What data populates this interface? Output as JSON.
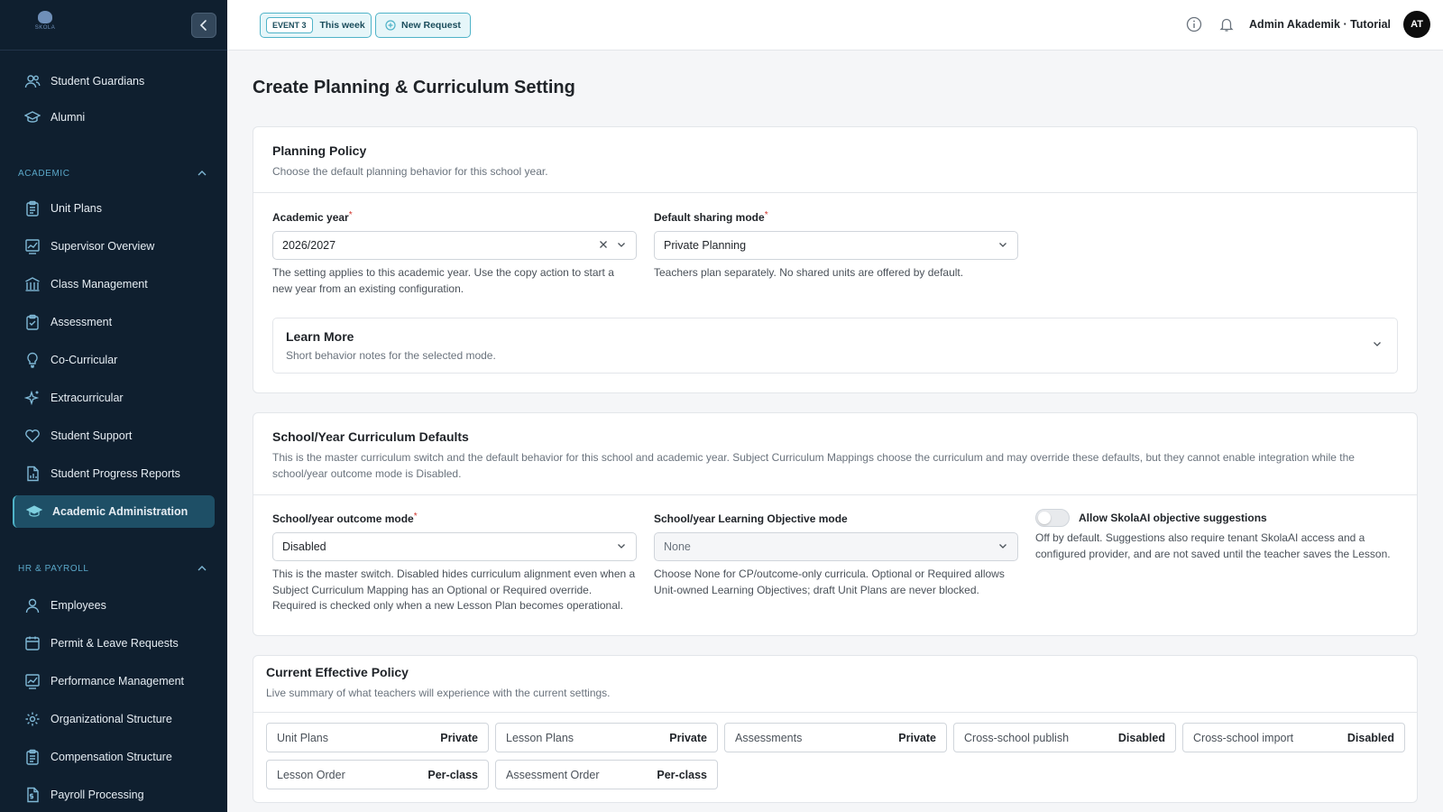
{
  "sidebar": {
    "logo_text": "SKOLA",
    "items_top": [
      {
        "label": "Student Guardians",
        "icon": "users-icon"
      },
      {
        "label": "Alumni",
        "icon": "graduation-cap-icon"
      }
    ],
    "academic_header": "ACADEMIC",
    "academic_items": [
      {
        "label": "Unit Plans",
        "icon": "clipboard-icon"
      },
      {
        "label": "Supervisor Overview",
        "icon": "chart-icon"
      },
      {
        "label": "Class Management",
        "icon": "building-icon"
      },
      {
        "label": "Assessment",
        "icon": "clipboard-check-icon"
      },
      {
        "label": "Co-Curricular",
        "icon": "lightbulb-icon"
      },
      {
        "label": "Extracurricular",
        "icon": "sparkles-icon"
      },
      {
        "label": "Student Support",
        "icon": "heart-icon"
      },
      {
        "label": "Student Progress Reports",
        "icon": "document-chart-icon"
      },
      {
        "label": "Academic Administration",
        "icon": "graduation-cap-icon",
        "active": true
      }
    ],
    "hr_header": "HR & PAYROLL",
    "hr_items": [
      {
        "label": "Employees",
        "icon": "user-icon"
      },
      {
        "label": "Permit & Leave Requests",
        "icon": "calendar-icon"
      },
      {
        "label": "Performance Management",
        "icon": "chart-icon"
      },
      {
        "label": "Organizational Structure",
        "icon": "gear-icon"
      },
      {
        "label": "Compensation Structure",
        "icon": "clipboard-icon"
      },
      {
        "label": "Payroll Processing",
        "icon": "document-dollar-icon"
      }
    ]
  },
  "topbar": {
    "event_badge": "EVENT 3",
    "event_label": "This week",
    "new_request_label": "New Request",
    "user_name": "Admin Akademik · Tutorial",
    "avatar_initials": "AT"
  },
  "page_title": "Create Planning & Curriculum Setting",
  "planning_policy": {
    "title": "Planning Policy",
    "description": "Choose the default planning behavior for this school year.",
    "academic_year": {
      "label": "Academic year",
      "required_mark": "*",
      "value": "2026/2027",
      "help": "The setting applies to this academic year. Use the copy action to start a new year from an existing configuration."
    },
    "sharing_mode": {
      "label": "Default sharing mode",
      "required_mark": "*",
      "value": "Private Planning",
      "help": "Teachers plan separately. No shared units are offered by default."
    },
    "learn_more": {
      "title": "Learn More",
      "description": "Short behavior notes for the selected mode."
    }
  },
  "curriculum_defaults": {
    "title": "School/Year Curriculum Defaults",
    "description": "This is the master curriculum switch and the default behavior for this school and academic year. Subject Curriculum Mappings choose the curriculum and may override these defaults, but they cannot enable integration while the school/year outcome mode is Disabled.",
    "outcome_mode": {
      "label": "School/year outcome mode",
      "required_mark": "*",
      "value": "Disabled",
      "help": "This is the master switch. Disabled hides curriculum alignment even when a Subject Curriculum Mapping has an Optional or Required override. Required is checked only when a new Lesson Plan becomes operational."
    },
    "objective_mode": {
      "label": "School/year Learning Objective mode",
      "value": "None",
      "help": "Choose None for CP/outcome-only curricula. Optional or Required allows Unit-owned Learning Objectives; draft Unit Plans are never blocked."
    },
    "ai_toggle": {
      "label": "Allow SkolaAI objective suggestions",
      "enabled": false,
      "help": "Off by default. Suggestions also require tenant SkolaAI access and a configured provider, and are not saved until the teacher saves the Lesson."
    }
  },
  "effective_policy": {
    "title": "Current Effective Policy",
    "description": "Live summary of what teachers will experience with the current settings.",
    "cells": [
      {
        "key": "Unit Plans",
        "value": "Private"
      },
      {
        "key": "Lesson Plans",
        "value": "Private"
      },
      {
        "key": "Assessments",
        "value": "Private"
      },
      {
        "key": "Cross-school publish",
        "value": "Disabled"
      },
      {
        "key": "Cross-school import",
        "value": "Disabled"
      },
      {
        "key": "Lesson Order",
        "value": "Per-class"
      },
      {
        "key": "Assessment Order",
        "value": "Per-class"
      }
    ]
  },
  "colors": {
    "sidebar_bg": "#0f1f2f",
    "active_item": "#1e4f66",
    "accent": "#4fb3c8",
    "required": "#d0342c"
  }
}
